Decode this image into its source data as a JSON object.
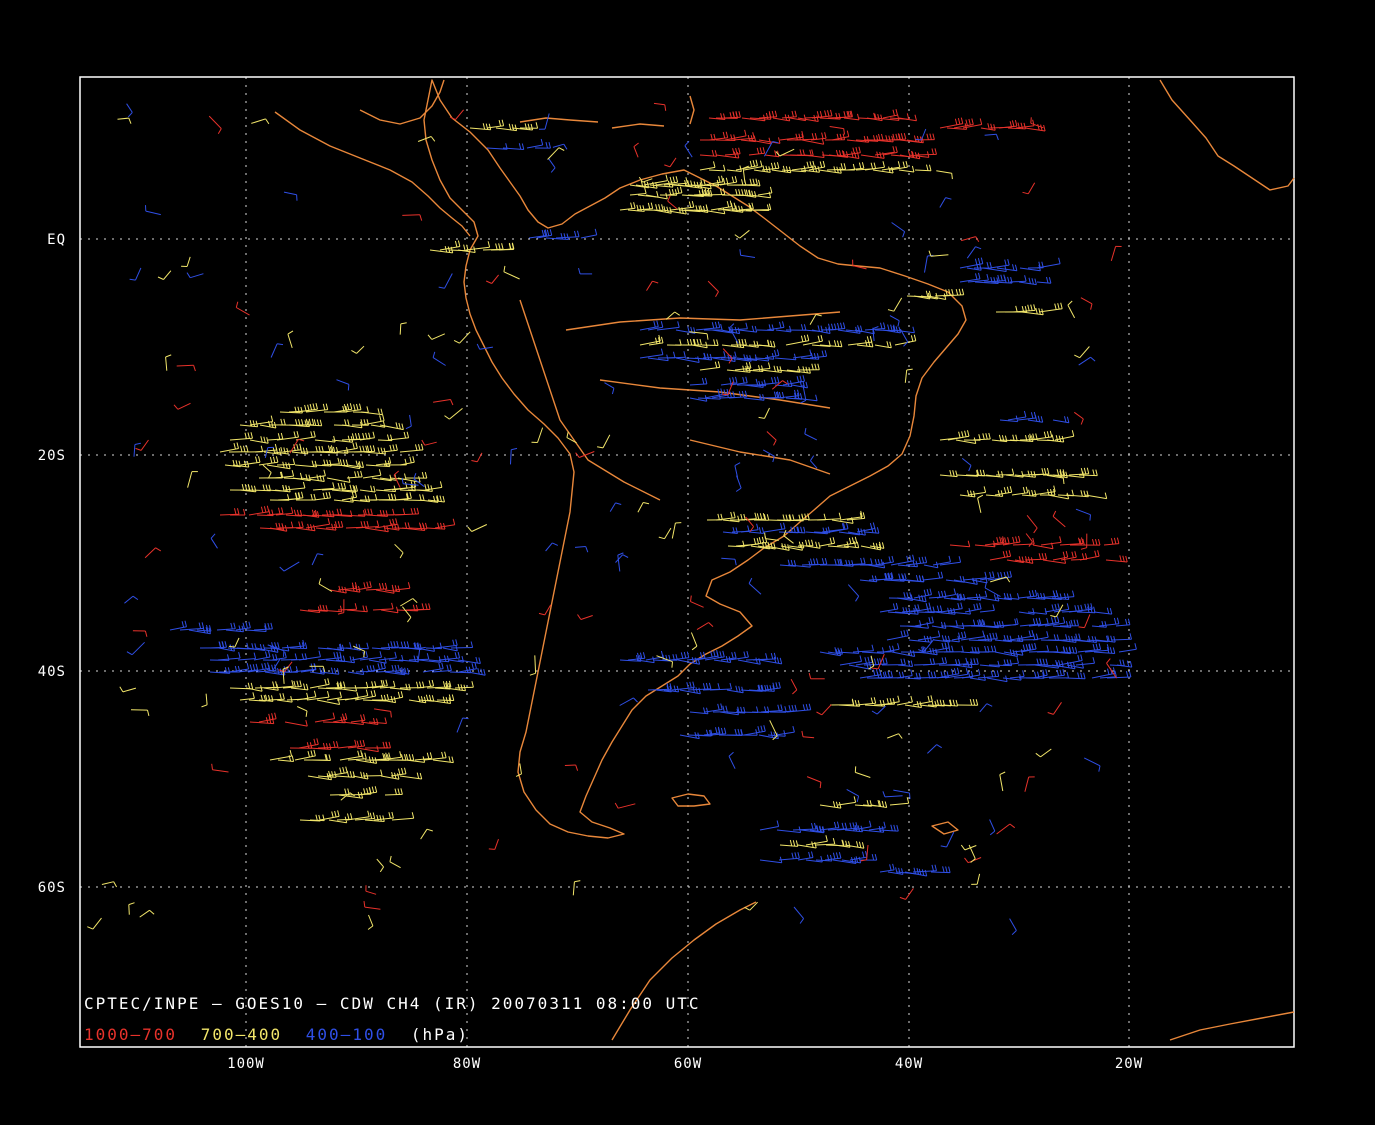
{
  "map": {
    "title": "CPTEC/INPE – GOES10 – CDW CH4 (IR) 20070311 08:00 UTC",
    "legend": {
      "bands": [
        {
          "label": "1000–700",
          "color": "#e8322b"
        },
        {
          "label": "700–400",
          "color": "#f2e66a"
        },
        {
          "label": "400–100",
          "color": "#2f4fe6"
        }
      ],
      "unit": "(hPa)"
    },
    "latitude_labels": [
      "EQ",
      "20S",
      "40S",
      "60S"
    ],
    "longitude_labels": [
      "100W",
      "80W",
      "60W",
      "40W",
      "20W"
    ],
    "extent": {
      "lon_min": -115,
      "lon_max": -5,
      "lat_min": -75,
      "lat_max": 15
    },
    "coastline_color": "#e8873a",
    "grid_color": "#ffffff"
  }
}
